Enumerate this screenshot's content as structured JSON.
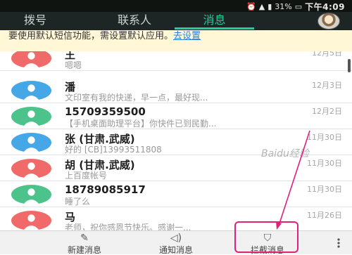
{
  "status_bar": {
    "battery": "31%",
    "time": "下午4:09"
  },
  "tabs": [
    "拨号",
    "联系人",
    "消息"
  ],
  "banner": {
    "text": "要使用默认短信功能，需设置默认应用。",
    "link": "去设置"
  },
  "messages": [
    {
      "name": "王 ",
      "preview": "嗯嗯",
      "date": "12月5日",
      "avatar_color": "#f06a6a"
    },
    {
      "name": "潘",
      "preview": "文印室有我的快递，早一点，最好现...",
      "date": "12月3日",
      "avatar_color": "#45a7e6"
    },
    {
      "name": "15709359500",
      "preview": "【手机桌面助理平台】你快件已到民勤...",
      "date": "12月2日",
      "avatar_color": "#4cc38a"
    },
    {
      "name": "张  (甘肃.武威)",
      "preview": "好的 [CB]13993511808",
      "date": "11月30日",
      "avatar_color": "#45a7e6"
    },
    {
      "name": "胡  (甘肃.武威)",
      "preview": "上百度帐号",
      "date": "11月30日",
      "avatar_color": "#f06a6a"
    },
    {
      "name": "18789085917",
      "preview": "睡了么",
      "date": "11月30日",
      "avatar_color": "#4cc38a"
    },
    {
      "name": "马",
      "preview": "老师，祝你感恩节快乐。感谢一...",
      "date": "11月26日",
      "avatar_color": "#f06a6a"
    }
  ],
  "bottom_bar": {
    "new_message": "新建消息",
    "notifications": "通知消息",
    "blocked": "拦截消息"
  },
  "watermark": "Baidu经验",
  "colors": {
    "accent": "#28c99a",
    "annotation": "#e0217b"
  }
}
